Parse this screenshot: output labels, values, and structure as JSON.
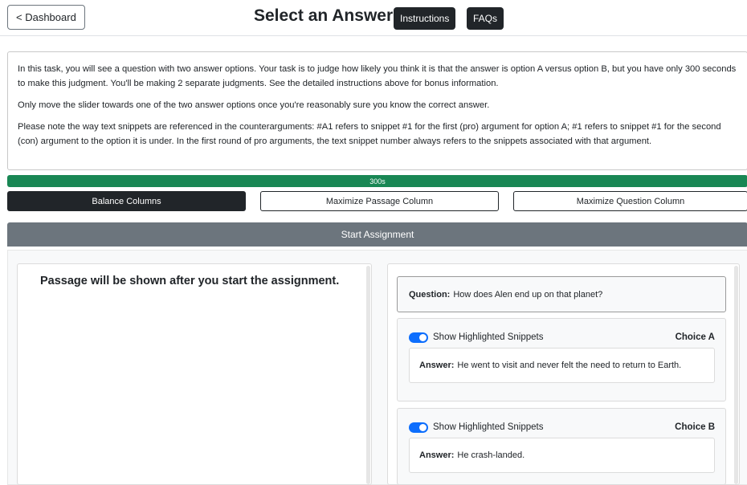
{
  "header": {
    "back_label": "< Dashboard",
    "title": "Select an Answer",
    "instructions_label": "Instructions",
    "faqs_label": "FAQs"
  },
  "instructions_text": {
    "p1": "In this task, you will see a question with two answer options. Your task is to judge how likely you think it is that the answer is option A versus option B, but you have only 300 seconds to make this judgment. You'll be making 2 separate judgments. See the detailed instructions above for bonus information.",
    "p2": "Only move the slider towards one of the two answer options once you're reasonably sure you know the correct answer.",
    "p3": "Please note the way text snippets are referenced in the counterarguments: #A1 refers to snippet #1 for the first (pro) argument for option A; #1 refers to snippet #1 for the second (con) argument to the option it is under. In the first round of pro arguments, the text snippet number always refers to the snippets associated with that argument."
  },
  "timer": {
    "label": "300s",
    "fraction": 1.0
  },
  "layout_buttons": {
    "balance": "Balance Columns",
    "max_passage": "Maximize Passage Column",
    "max_question": "Maximize Question Column"
  },
  "start_label": "Start Assignment",
  "passage": {
    "message": "Passage will be shown after you start the assignment."
  },
  "question": {
    "prefix": "Question:",
    "text": "How does Alen end up on that planet?"
  },
  "choices": [
    {
      "toggle_label": "Show Highlighted Snippets",
      "toggle_on": true,
      "choice_label": "Choice A",
      "answer_prefix": "Answer:",
      "answer_text": "He went to visit and never felt the need to return to Earth."
    },
    {
      "toggle_label": "Show Highlighted Snippets",
      "toggle_on": true,
      "choice_label": "Choice B",
      "answer_prefix": "Answer:",
      "answer_text": "He crash-landed."
    }
  ],
  "colors": {
    "progress": "#198754",
    "toggle": "#0d6efd",
    "dark": "#212529",
    "bar": "#6c757d"
  }
}
